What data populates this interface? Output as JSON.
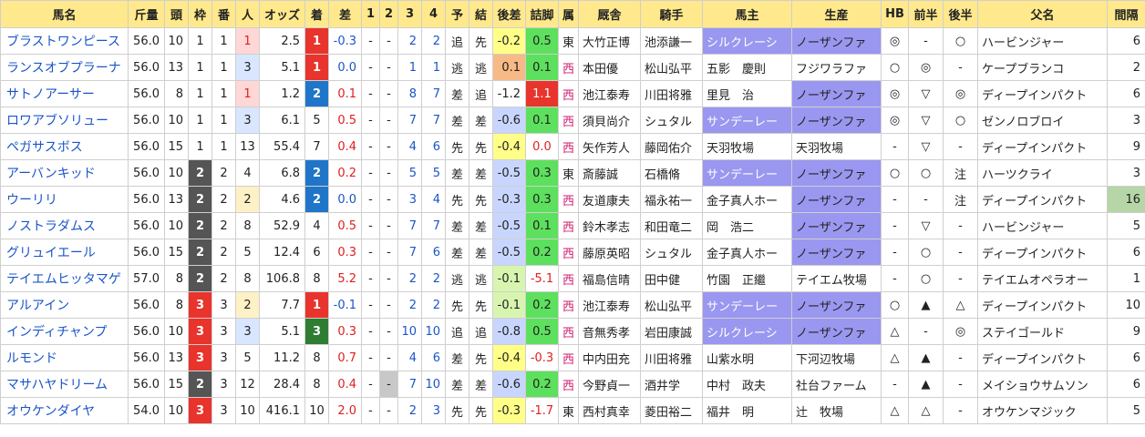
{
  "columns": [
    "馬名",
    "斤量",
    "頭",
    "枠",
    "番",
    "人",
    "オッズ",
    "着",
    "差",
    "1",
    "2",
    "3",
    "4",
    "予",
    "結",
    "後差",
    "詰脚",
    "属",
    "厩舎",
    "騎手",
    "馬主",
    "生産",
    "HB",
    "前半",
    "後半",
    "父名",
    "間隔"
  ],
  "rows": [
    {
      "name": "ブラストワンピース",
      "kin": "56.0",
      "to": "10",
      "waku": "1",
      "ban": "1",
      "pop": "1",
      "odds": "2.5",
      "chaku": "1",
      "sa": "-0.3",
      "p1": "-",
      "p2": "-",
      "p3": "2",
      "p4": "2",
      "yo": "追",
      "ketsu": "先",
      "gosa": "-0.2",
      "tsume": "0.5",
      "zoku": "東",
      "kyusha": "大竹正博",
      "kishu": "池添謙一",
      "owner": "シルクレーシ",
      "farm": "ノーザンファ",
      "hb": "◎",
      "zen": "-",
      "kou": "○",
      "chichi": "ハービンジャー",
      "kankaku": "6"
    },
    {
      "name": "ランスオブプラーナ",
      "kin": "56.0",
      "to": "13",
      "waku": "1",
      "ban": "1",
      "pop": "3",
      "odds": "5.1",
      "chaku": "1",
      "sa": "0.0",
      "p1": "-",
      "p2": "-",
      "p3": "1",
      "p4": "1",
      "yo": "逃",
      "ketsu": "逃",
      "gosa": "0.1",
      "tsume": "0.1",
      "zoku": "西",
      "kyusha": "本田優",
      "kishu": "松山弘平",
      "owner": "五影　慶則",
      "farm": "フジワラファ",
      "hb": "○",
      "zen": "◎",
      "kou": "-",
      "chichi": "ケープブランコ",
      "kankaku": "2"
    },
    {
      "name": "サトノアーサー",
      "kin": "56.0",
      "to": "8",
      "waku": "1",
      "ban": "1",
      "pop": "1",
      "odds": "1.2",
      "chaku": "2",
      "sa": "0.1",
      "p1": "-",
      "p2": "-",
      "p3": "8",
      "p4": "7",
      "yo": "差",
      "ketsu": "追",
      "gosa": "-1.2",
      "tsume": "1.1",
      "zoku": "西",
      "kyusha": "池江泰寿",
      "kishu": "川田将雅",
      "owner": "里見　治",
      "farm": "ノーザンファ",
      "hb": "◎",
      "zen": "▽",
      "kou": "◎",
      "chichi": "ディープインパクト",
      "kankaku": "6"
    },
    {
      "name": "ロワアブソリュー",
      "kin": "56.0",
      "to": "10",
      "waku": "1",
      "ban": "1",
      "pop": "3",
      "odds": "6.1",
      "chaku": "5",
      "sa": "0.5",
      "p1": "-",
      "p2": "-",
      "p3": "7",
      "p4": "7",
      "yo": "差",
      "ketsu": "差",
      "gosa": "-0.6",
      "tsume": "0.1",
      "zoku": "西",
      "kyusha": "須貝尚介",
      "kishu": "シュタル",
      "owner": "サンデーレー",
      "farm": "ノーザンファ",
      "hb": "◎",
      "zen": "▽",
      "kou": "○",
      "chichi": "ゼンノロブロイ",
      "kankaku": "3"
    },
    {
      "name": "ペガサスボス",
      "kin": "56.0",
      "to": "15",
      "waku": "1",
      "ban": "1",
      "pop": "13",
      "odds": "55.4",
      "chaku": "7",
      "sa": "0.4",
      "p1": "-",
      "p2": "-",
      "p3": "4",
      "p4": "6",
      "yo": "先",
      "ketsu": "先",
      "gosa": "-0.4",
      "tsume": "0.0",
      "zoku": "西",
      "kyusha": "矢作芳人",
      "kishu": "藤岡佑介",
      "owner": "天羽牧場",
      "farm": "天羽牧場",
      "hb": "-",
      "zen": "▽",
      "kou": "-",
      "chichi": "ディープインパクト",
      "kankaku": "9"
    },
    {
      "name": "アーバンキッド",
      "kin": "56.0",
      "to": "10",
      "waku": "2",
      "ban": "2",
      "pop": "4",
      "odds": "6.8",
      "chaku": "2",
      "sa": "0.2",
      "p1": "-",
      "p2": "-",
      "p3": "5",
      "p4": "5",
      "yo": "差",
      "ketsu": "差",
      "gosa": "-0.5",
      "tsume": "0.3",
      "zoku": "東",
      "kyusha": "斎藤誠",
      "kishu": "石橋脩",
      "owner": "サンデーレー",
      "farm": "ノーザンファ",
      "hb": "○",
      "zen": "○",
      "kou": "注",
      "chichi": "ハーツクライ",
      "kankaku": "3"
    },
    {
      "name": "ウーリリ",
      "kin": "56.0",
      "to": "13",
      "waku": "2",
      "ban": "2",
      "pop": "2",
      "odds": "4.6",
      "chaku": "2",
      "sa": "0.0",
      "p1": "-",
      "p2": "-",
      "p3": "3",
      "p4": "4",
      "yo": "先",
      "ketsu": "先",
      "gosa": "-0.3",
      "tsume": "0.3",
      "zoku": "西",
      "kyusha": "友道康夫",
      "kishu": "福永祐一",
      "owner": "金子真人ホー",
      "farm": "ノーザンファ",
      "hb": "-",
      "zen": "-",
      "kou": "注",
      "chichi": "ディープインパクト",
      "kankaku": "16"
    },
    {
      "name": "ノストラダムス",
      "kin": "56.0",
      "to": "10",
      "waku": "2",
      "ban": "2",
      "pop": "8",
      "odds": "52.9",
      "chaku": "4",
      "sa": "0.5",
      "p1": "-",
      "p2": "-",
      "p3": "7",
      "p4": "7",
      "yo": "差",
      "ketsu": "差",
      "gosa": "-0.5",
      "tsume": "0.1",
      "zoku": "西",
      "kyusha": "鈴木孝志",
      "kishu": "和田竜二",
      "owner": "岡　浩二",
      "farm": "ノーザンファ",
      "hb": "-",
      "zen": "▽",
      "kou": "-",
      "chichi": "ハービンジャー",
      "kankaku": "5"
    },
    {
      "name": "グリュイエール",
      "kin": "56.0",
      "to": "15",
      "waku": "2",
      "ban": "2",
      "pop": "5",
      "odds": "12.4",
      "chaku": "6",
      "sa": "0.3",
      "p1": "-",
      "p2": "-",
      "p3": "7",
      "p4": "6",
      "yo": "差",
      "ketsu": "差",
      "gosa": "-0.5",
      "tsume": "0.2",
      "zoku": "西",
      "kyusha": "藤原英昭",
      "kishu": "シュタル",
      "owner": "金子真人ホー",
      "farm": "ノーザンファ",
      "hb": "-",
      "zen": "○",
      "kou": "-",
      "chichi": "ディープインパクト",
      "kankaku": "6"
    },
    {
      "name": "テイエムヒッタマゲ",
      "kin": "57.0",
      "to": "8",
      "waku": "2",
      "ban": "2",
      "pop": "8",
      "odds": "106.8",
      "chaku": "8",
      "sa": "5.2",
      "p1": "-",
      "p2": "-",
      "p3": "2",
      "p4": "2",
      "yo": "逃",
      "ketsu": "逃",
      "gosa": "-0.1",
      "tsume": "-5.1",
      "zoku": "西",
      "kyusha": "福島信晴",
      "kishu": "田中健",
      "owner": "竹園　正繼",
      "farm": "テイエム牧場",
      "hb": "-",
      "zen": "○",
      "kou": "-",
      "chichi": "テイエムオペラオー",
      "kankaku": "1"
    },
    {
      "name": "アルアイン",
      "kin": "56.0",
      "to": "8",
      "waku": "3",
      "ban": "3",
      "pop": "2",
      "odds": "7.7",
      "chaku": "1",
      "sa": "-0.1",
      "p1": "-",
      "p2": "-",
      "p3": "2",
      "p4": "2",
      "yo": "先",
      "ketsu": "先",
      "gosa": "-0.1",
      "tsume": "0.2",
      "zoku": "西",
      "kyusha": "池江泰寿",
      "kishu": "松山弘平",
      "owner": "サンデーレー",
      "farm": "ノーザンファ",
      "hb": "○",
      "zen": "▲",
      "kou": "△",
      "chichi": "ディープインパクト",
      "kankaku": "10"
    },
    {
      "name": "インディチャンプ",
      "kin": "56.0",
      "to": "10",
      "waku": "3",
      "ban": "3",
      "pop": "3",
      "odds": "5.1",
      "chaku": "3",
      "sa": "0.3",
      "p1": "-",
      "p2": "-",
      "p3": "10",
      "p4": "10",
      "yo": "追",
      "ketsu": "追",
      "gosa": "-0.8",
      "tsume": "0.5",
      "zoku": "西",
      "kyusha": "音無秀孝",
      "kishu": "岩田康誠",
      "owner": "シルクレーシ",
      "farm": "ノーザンファ",
      "hb": "△",
      "zen": "-",
      "kou": "◎",
      "chichi": "ステイゴールド",
      "kankaku": "9"
    },
    {
      "name": "ルモンド",
      "kin": "56.0",
      "to": "13",
      "waku": "3",
      "ban": "3",
      "pop": "5",
      "odds": "11.2",
      "chaku": "8",
      "sa": "0.7",
      "p1": "-",
      "p2": "-",
      "p3": "4",
      "p4": "6",
      "yo": "差",
      "ketsu": "先",
      "gosa": "-0.4",
      "tsume": "-0.3",
      "zoku": "西",
      "kyusha": "中内田充",
      "kishu": "川田将雅",
      "owner": "山紫水明",
      "farm": "下河辺牧場",
      "hb": "△",
      "zen": "▲",
      "kou": "-",
      "chichi": "ディープインパクト",
      "kankaku": "6"
    },
    {
      "name": "マサハヤドリーム",
      "kin": "56.0",
      "to": "15",
      "waku": "2",
      "ban": "3",
      "pop": "12",
      "odds": "28.4",
      "chaku": "8",
      "sa": "0.4",
      "p1": "-",
      "p2": "-",
      "p3": "7",
      "p4": "10",
      "yo": "差",
      "ketsu": "差",
      "gosa": "-0.6",
      "tsume": "0.2",
      "zoku": "西",
      "kyusha": "今野貞一",
      "kishu": "酒井学",
      "owner": "中村　政夫",
      "farm": "社台ファーム",
      "hb": "-",
      "zen": "▲",
      "kou": "-",
      "chichi": "メイショウサムソン",
      "kankaku": "6"
    },
    {
      "name": "オウケンダイヤ",
      "kin": "54.0",
      "to": "10",
      "waku": "3",
      "ban": "3",
      "pop": "10",
      "odds": "416.1",
      "chaku": "10",
      "sa": "2.0",
      "p1": "-",
      "p2": "-",
      "p3": "2",
      "p4": "3",
      "yo": "先",
      "ketsu": "先",
      "gosa": "-0.3",
      "tsume": "-1.7",
      "zoku": "東",
      "kyusha": "西村真幸",
      "kishu": "菱田裕二",
      "owner": "福井　明",
      "farm": "辻　牧場",
      "hb": "△",
      "zen": "△",
      "kou": "-",
      "chichi": "オウケンマジック",
      "kankaku": "5"
    }
  ]
}
